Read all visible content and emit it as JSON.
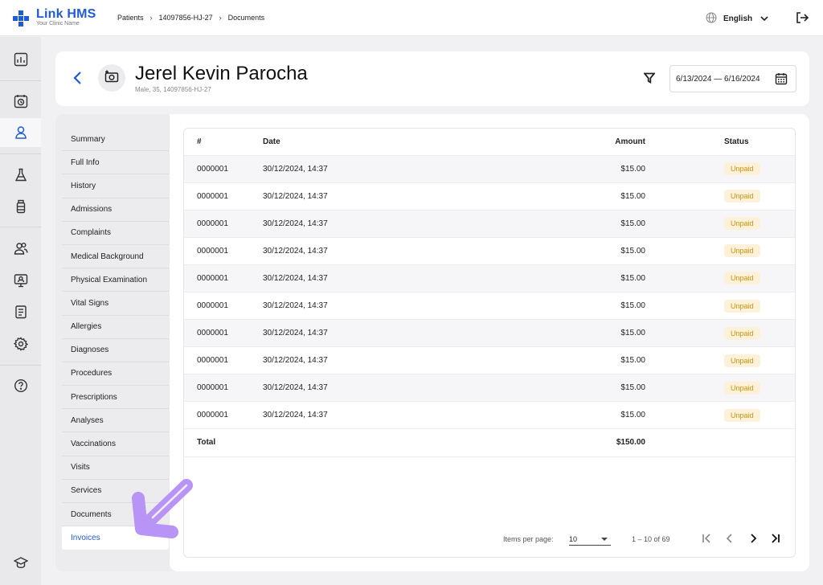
{
  "brand": {
    "name": "Link HMS",
    "subtitle": "Your Clinic Name",
    "color": "#1e5bd6"
  },
  "breadcrumb": [
    "Patients",
    "14097856-HJ-27",
    "Documents"
  ],
  "language": {
    "label": "English",
    "icon": "globe-icon"
  },
  "rail_icons": [
    "dashboard-icon",
    "calendar-clock-icon",
    "user-icon",
    "flask-icon",
    "medicine-bottle-icon",
    "users-icon",
    "monitor-user-icon",
    "clipboard-icon",
    "gear-icon",
    "help-icon",
    "graduation-cap-icon"
  ],
  "patient": {
    "name": "Jerel Kevin Parocha",
    "meta": "Male, 35, 14097856-HJ-27",
    "date_range": "6/13/2024 — 6/16/2024"
  },
  "side_nav": {
    "items": [
      "Summary",
      "Full Info",
      "History",
      "Admissions",
      "Complaints",
      "Medical Background",
      "Physical Examination",
      "Vital Signs",
      "Allergies",
      "Diagnoses",
      "Procedures",
      "Prescriptions",
      "Analyses",
      "Vaccinations",
      "Visits",
      "Services",
      "Documents",
      "Invoices"
    ],
    "active": "Invoices"
  },
  "table": {
    "headers": {
      "num": "#",
      "date": "Date",
      "amount": "Amount",
      "status": "Status"
    },
    "rows": [
      {
        "num": "0000001",
        "date": "30/12/2024, 14:37",
        "amount": "$15.00",
        "status": "Unpaid"
      },
      {
        "num": "0000001",
        "date": "30/12/2024, 14:37",
        "amount": "$15.00",
        "status": "Unpaid"
      },
      {
        "num": "0000001",
        "date": "30/12/2024, 14:37",
        "amount": "$15.00",
        "status": "Unpaid"
      },
      {
        "num": "0000001",
        "date": "30/12/2024, 14:37",
        "amount": "$15.00",
        "status": "Unpaid"
      },
      {
        "num": "0000001",
        "date": "30/12/2024, 14:37",
        "amount": "$15.00",
        "status": "Unpaid"
      },
      {
        "num": "0000001",
        "date": "30/12/2024, 14:37",
        "amount": "$15.00",
        "status": "Unpaid"
      },
      {
        "num": "0000001",
        "date": "30/12/2024, 14:37",
        "amount": "$15.00",
        "status": "Unpaid"
      },
      {
        "num": "0000001",
        "date": "30/12/2024, 14:37",
        "amount": "$15.00",
        "status": "Unpaid"
      },
      {
        "num": "0000001",
        "date": "30/12/2024, 14:37",
        "amount": "$15.00",
        "status": "Unpaid"
      },
      {
        "num": "0000001",
        "date": "30/12/2024, 14:37",
        "amount": "$15.00",
        "status": "Unpaid"
      }
    ],
    "total_label": "Total",
    "total_amount": "$150.00",
    "status_colors": {
      "unpaid_bg": "#fdf1d9",
      "unpaid_text": "#d4920a"
    }
  },
  "pagination": {
    "items_per_page_label": "Items per page:",
    "items_per_page_value": "10",
    "range_text": "1 – 10 of 69"
  },
  "annotation": {
    "arrow_color": "#b794f6"
  }
}
